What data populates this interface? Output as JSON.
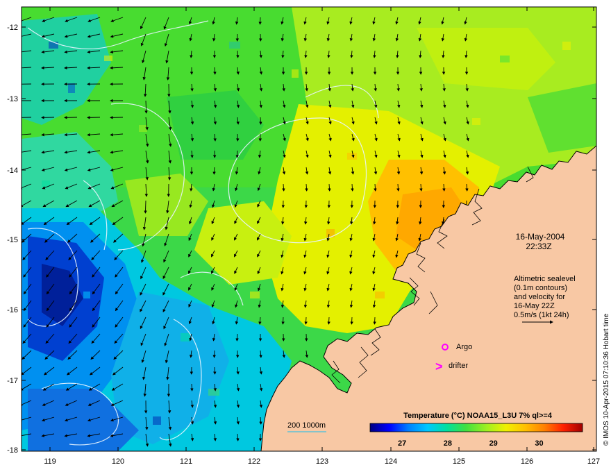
{
  "map": {
    "lon_ticks": [
      "119",
      "120",
      "121",
      "122",
      "123",
      "124",
      "125",
      "126",
      "127"
    ],
    "lat_ticks": [
      "-12",
      "-13",
      "-14",
      "-15",
      "-16",
      "-17",
      "-18"
    ],
    "lon_range": [
      118.6,
      127.0
    ],
    "lat_range": [
      -18.0,
      -11.8
    ],
    "land_color": "#f8c8a4",
    "coast_color": "#000000",
    "contour_color": "#e8f4ff",
    "arrow_color": "#000000"
  },
  "annotations": {
    "date": "16-May-2004",
    "time": "22:33Z",
    "alt_line1": "Altimetric sealevel",
    "alt_line2": "(0.1m contours)",
    "alt_line3": "and velocity for",
    "alt_line4": "16-May 22Z",
    "alt_line5": "0.5m/s (1kt 24h)"
  },
  "legend": {
    "argo_label": "Argo",
    "drifter_label": "drifter",
    "drifter_symbol": ">",
    "marker_color": "#ff00ff",
    "depth_label": "200  1000m",
    "depth_line_color": "#40c0e0"
  },
  "colorbar": {
    "title": "Temperature (°C) NOAA15_L3U 7% ql>=4",
    "ticks": [
      "27",
      "28",
      "29",
      "30"
    ],
    "tick_values": [
      27,
      28,
      29,
      30
    ],
    "range": [
      26.3,
      30.95
    ],
    "colors": [
      "#000080",
      "#0000ff",
      "#0080ff",
      "#00c8ff",
      "#00e0a0",
      "#40e040",
      "#a0f020",
      "#f0f000",
      "#ffc000",
      "#ff8000",
      "#ff2000",
      "#a00000"
    ]
  },
  "credit": "© IMOS 10-Apr-2015 07:10:36 Hobart time"
}
